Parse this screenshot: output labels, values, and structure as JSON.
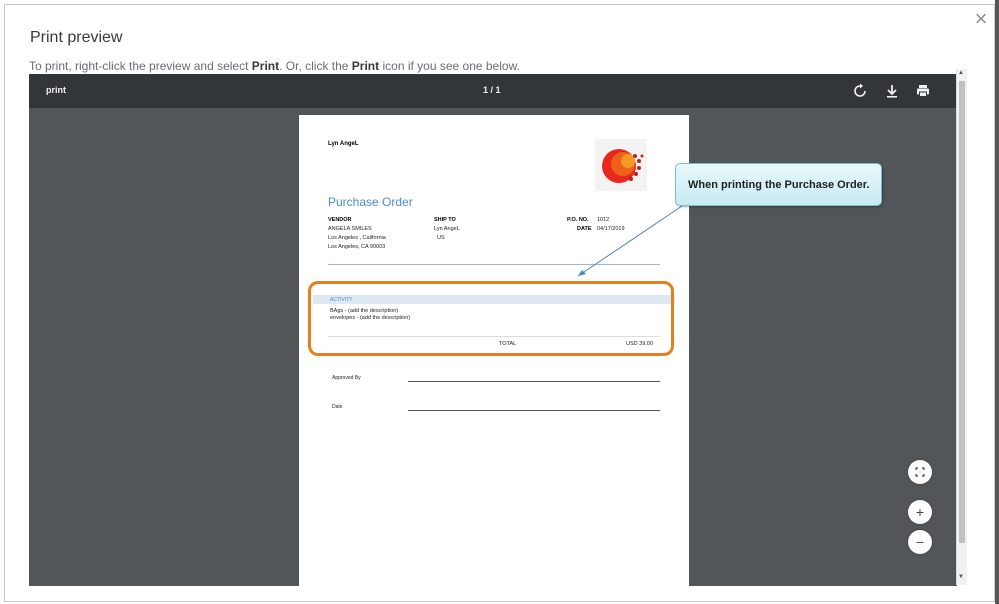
{
  "dialog": {
    "title": "Print preview",
    "instructions_parts": [
      "To print, right-click the preview and select ",
      "Print",
      ". Or, click the ",
      "Print",
      " icon if you see one below."
    ],
    "close_icon": "close-icon"
  },
  "viewer_toolbar": {
    "doc_title": "print",
    "page_indicator": "1 / 1",
    "icons": [
      "rotate-icon",
      "download-icon",
      "print-icon"
    ]
  },
  "document": {
    "company": "Lyn AngeL",
    "title": "Purchase Order",
    "vendor_label": "VENDOR",
    "vendor_lines": [
      "ANGELA SMILES",
      "Los Angeles , California",
      "Los Angeles, CA  90003"
    ],
    "ship_to_label": "SHIP TO",
    "ship_to_lines": [
      "Lyn AngeL",
      "US"
    ],
    "po_no_label": "P.O. NO.",
    "po_no": "1012",
    "date_label": "DATE",
    "date": "04/17/2019",
    "activity_header": "ACTIVITY",
    "activity_items": [
      "BAgs - (add the description)",
      "envelopes - (add the description)"
    ],
    "total_label": "TOTAL",
    "total_value": "USD 39.00",
    "approved_by_label": "Approved By",
    "date_sig_label": "Date"
  },
  "annotation": {
    "callout_text": "When printing the Purchase Order."
  },
  "zoom_controls": {
    "icons": [
      "fit-to-page-icon",
      "zoom-in-icon",
      "zoom-out-icon"
    ],
    "zoom_in_symbol": "+",
    "zoom_out_symbol": "−"
  },
  "colors": {
    "accent": "#4d8cc4",
    "highlight": "#e67e22",
    "viewer_bg": "#525659",
    "toolbar_bg": "#323639"
  }
}
